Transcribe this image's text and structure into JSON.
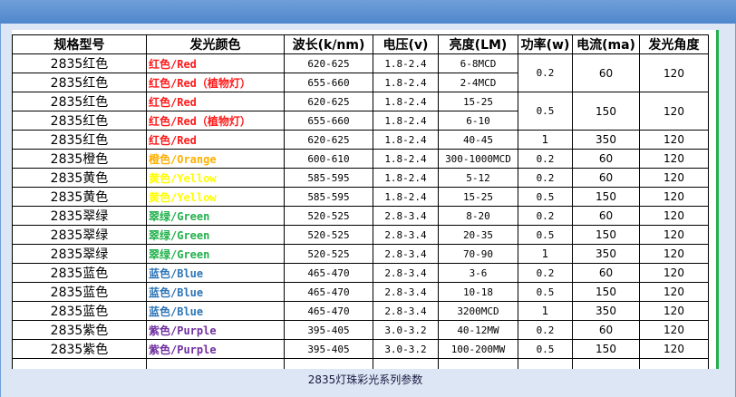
{
  "headers": [
    "规格型号",
    "发光颜色",
    "波长(k/nm)",
    "电压(v)",
    "亮度(LM)",
    "功率(w)",
    "电流(ma)",
    "发光角度"
  ],
  "rows": [
    {
      "model": "2835红色",
      "color": "红色/Red",
      "tone": "red",
      "wavelength": "620-625",
      "voltage": "1.8-2.4",
      "brightness": "6-8MCD"
    },
    {
      "model": "2835红色",
      "color": "红色/Red（植物灯）",
      "tone": "red",
      "wavelength": "655-660",
      "voltage": "1.8-2.4",
      "brightness": "2-4MCD"
    },
    {
      "model": "2835红色",
      "color": "红色/Red",
      "tone": "red",
      "wavelength": "620-625",
      "voltage": "1.8-2.4",
      "brightness": "15-25"
    },
    {
      "model": "2835红色",
      "color": "红色/Red（植物灯）",
      "tone": "red",
      "wavelength": "655-660",
      "voltage": "1.8-2.4",
      "brightness": "6-10"
    },
    {
      "model": "2835红色",
      "color": "红色/Red",
      "tone": "red",
      "wavelength": "620-625",
      "voltage": "1.8-2.4",
      "brightness": "40-45",
      "power": "1",
      "current": "350",
      "angle": "120"
    },
    {
      "model": "2835橙色",
      "color": "橙色/Orange",
      "tone": "orange",
      "wavelength": "600-610",
      "voltage": "1.8-2.4",
      "brightness": "300-1000MCD",
      "power": "0.2",
      "current": "60",
      "angle": "120"
    },
    {
      "model": "2835黄色",
      "color": "黄色/Yellow",
      "tone": "yellow",
      "wavelength": "585-595",
      "voltage": "1.8-2.4",
      "brightness": "5-12",
      "power": "0.2",
      "current": "60",
      "angle": "120"
    },
    {
      "model": "2835黄色",
      "color": "黄色/Yellow",
      "tone": "yellow",
      "wavelength": "585-595",
      "voltage": "1.8-2.4",
      "brightness": "15-25",
      "power": "0.5",
      "current": "150",
      "angle": "120"
    },
    {
      "model": "2835翠绿",
      "color": "翠绿/Green",
      "tone": "green",
      "wavelength": "520-525",
      "voltage": "2.8-3.4",
      "brightness": "8-20",
      "power": "0.2",
      "current": "60",
      "angle": "120"
    },
    {
      "model": "2835翠绿",
      "color": "翠绿/Green",
      "tone": "green",
      "wavelength": "520-525",
      "voltage": "2.8-3.4",
      "brightness": "20-35",
      "power": "0.5",
      "current": "150",
      "angle": "120"
    },
    {
      "model": "2835翠绿",
      "color": "翠绿/Green",
      "tone": "green",
      "wavelength": "520-525",
      "voltage": "2.8-3.4",
      "brightness": "70-90",
      "power": "1",
      "current": "350",
      "angle": "120"
    },
    {
      "model": "2835蓝色",
      "color": "蓝色/Blue",
      "tone": "blue",
      "wavelength": "465-470",
      "voltage": "2.8-3.4",
      "brightness": "3-6",
      "power": "0.2",
      "current": "60",
      "angle": "120"
    },
    {
      "model": "2835蓝色",
      "color": "蓝色/Blue",
      "tone": "blue",
      "wavelength": "465-470",
      "voltage": "2.8-3.4",
      "brightness": "10-18",
      "power": "0.5",
      "current": "150",
      "angle": "120"
    },
    {
      "model": "2835蓝色",
      "color": "蓝色/Blue",
      "tone": "blue",
      "wavelength": "465-470",
      "voltage": "2.8-3.4",
      "brightness": "3200MCD",
      "power": "1",
      "current": "350",
      "angle": "120"
    },
    {
      "model": "2835紫色",
      "color": "紫色/Purple",
      "tone": "purple",
      "wavelength": "395-405",
      "voltage": "3.0-3.2",
      "brightness": "40-12MW",
      "power": "0.2",
      "current": "60",
      "angle": "120"
    },
    {
      "model": "2835紫色",
      "color": "紫色/Purple",
      "tone": "purple",
      "wavelength": "395-405",
      "voltage": "3.0-3.2",
      "brightness": "100-200MW",
      "power": "0.5",
      "current": "150",
      "angle": "120"
    }
  ],
  "merged": {
    "group1": {
      "power": "0.2",
      "current": "60",
      "angle": "120"
    },
    "group2": {
      "power": "0.5",
      "current": "150",
      "angle": "120"
    }
  },
  "caption": "2835灯珠彩光系列参数",
  "colors": {
    "red": "#ff1a1a",
    "orange": "#ffb000",
    "yellow": "#ffff00",
    "green": "#22b14c",
    "blue": "#2e75b6",
    "purple": "#7030a0",
    "chrome": "#4f86cc"
  }
}
